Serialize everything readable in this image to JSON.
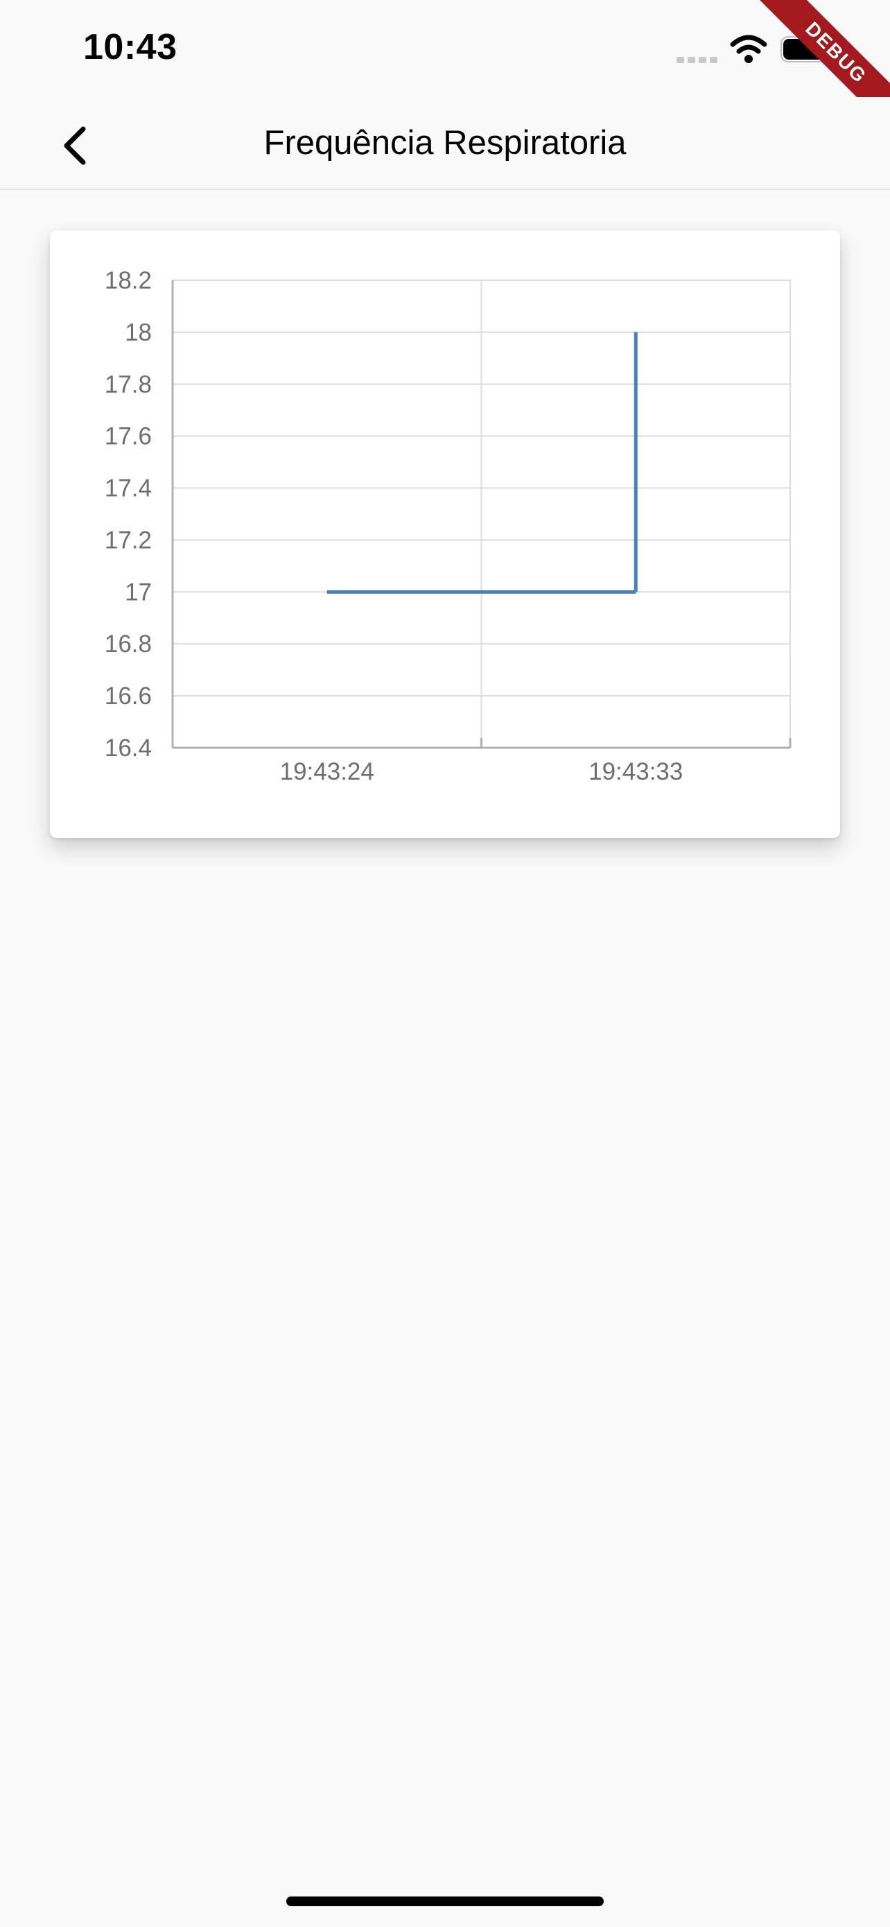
{
  "status_bar": {
    "time": "10:43",
    "icons": [
      "signal-icon",
      "wifi-icon",
      "battery-icon"
    ]
  },
  "debug_banner": "DEBUG",
  "app_bar": {
    "back_icon": "chevron-left-icon",
    "title": "Frequência Respiratoria"
  },
  "colors": {
    "background": "#f9f9f9",
    "line": "#4a7fbd",
    "grid": "#dcdcdc",
    "axis": "#b0b0b0",
    "debug": "#a3191e"
  },
  "chart_data": {
    "type": "line",
    "interpolation": "step",
    "title": "",
    "xlabel": "",
    "ylabel": "",
    "ylim": [
      16.4,
      18.2
    ],
    "y_ticks": [
      18.2,
      18,
      17.8,
      17.6,
      17.4,
      17.2,
      17,
      16.8,
      16.6,
      16.4
    ],
    "y_tick_labels": [
      "18.2",
      "18",
      "17.8",
      "17.6",
      "17.4",
      "17.2",
      "17",
      "16.8",
      "16.6",
      "16.4"
    ],
    "x_tick_labels": [
      "19:43:24",
      "19:43:33"
    ],
    "grid": true,
    "legend": "none",
    "series": [
      {
        "points": [
          {
            "x": "19:43:24",
            "y": 17
          },
          {
            "x": "19:43:33",
            "y": 17
          },
          {
            "x": "19:43:33",
            "y": 18
          }
        ]
      }
    ]
  }
}
